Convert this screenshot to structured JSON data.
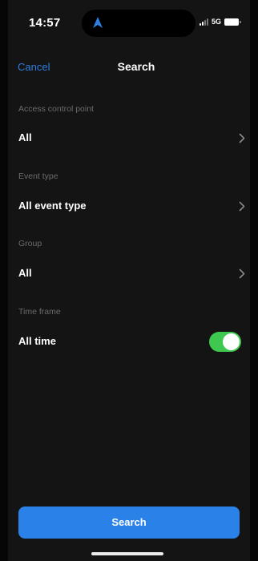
{
  "status_bar": {
    "time": "14:57",
    "network": "5G",
    "location_icon": "navigation-arrow-icon",
    "signal_icon": "cellular-signal-icon",
    "battery_icon": "battery-icon"
  },
  "nav": {
    "cancel_label": "Cancel",
    "title": "Search"
  },
  "filters": {
    "access_point": {
      "label": "Access control point",
      "value": "All"
    },
    "event_type": {
      "label": "Event type",
      "value": "All event type"
    },
    "group": {
      "label": "Group",
      "value": "All"
    },
    "time_frame": {
      "label": "Time frame",
      "value": "All time",
      "toggle_on": true
    }
  },
  "search_button_label": "Search",
  "colors": {
    "accent": "#2a82e8",
    "toggle_on": "#3fc84f",
    "background": "#141414",
    "section_label": "#6b6b6b"
  }
}
